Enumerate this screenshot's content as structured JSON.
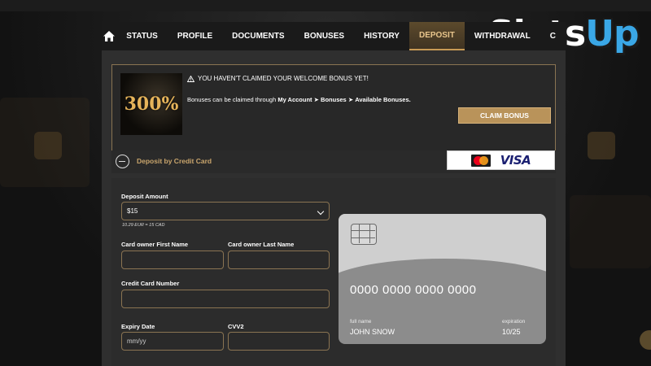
{
  "logo": {
    "text_a": "Slots",
    "text_b": "Up"
  },
  "nav": {
    "tabs": [
      {
        "label": "STATUS"
      },
      {
        "label": "PROFILE"
      },
      {
        "label": "DOCUMENTS"
      },
      {
        "label": "BONUSES"
      },
      {
        "label": "HISTORY"
      },
      {
        "label": "DEPOSIT",
        "active": true
      },
      {
        "label": "WITHDRAWAL"
      },
      {
        "label": "C"
      }
    ]
  },
  "banner": {
    "image_text": "300%",
    "title": "YOU HAVEN'T CLAIMED YOUR WELCOME BONUS YET!",
    "text_prefix": "Bonuses can be claimed through ",
    "path_1": "My Account",
    "path_2": "Bonuses",
    "path_3": "Available Bonuses.",
    "separator": "➤",
    "claim_label": "CLAIM BONUS"
  },
  "deposit": {
    "title": "Deposit by Credit Card",
    "visa": "VISA",
    "mastercard_label": "MasterCard"
  },
  "form": {
    "amount_label": "Deposit Amount",
    "amount_value": "$15",
    "rate_note": "10.29 EUR = 15 CAD",
    "first_name_label": "Card owner First Name",
    "last_name_label": "Card owner Last Name",
    "card_number_label": "Credit Card Number",
    "expiry_label": "Expiry Date",
    "expiry_placeholder": "mm/yy",
    "cvv_label": "CVV2"
  },
  "card_preview": {
    "number": "0000 0000 0000 0000",
    "full_name_label": "full name",
    "full_name_value": "JOHN SNOW",
    "expiration_label": "expiration",
    "expiration_value": "10/25"
  },
  "colors": {
    "accent_gold": "#c89a55",
    "claim_button": "#b9935a",
    "panel_bg": "#2f2f2f"
  }
}
